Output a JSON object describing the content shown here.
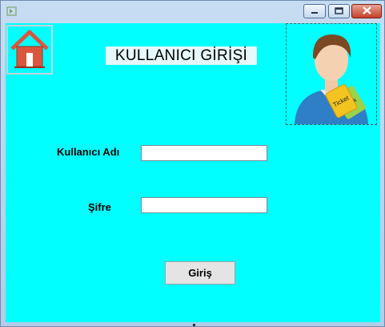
{
  "window": {
    "controls": {
      "minimize_icon": "minimize-icon",
      "maximize_icon": "maximize-icon",
      "close_icon": "close-icon"
    }
  },
  "home_button": {
    "icon": "home-icon"
  },
  "header": {
    "title": "KULLANICI GİRİŞİ"
  },
  "avatar": {
    "ticket_text_1": "Ticket",
    "ticket_text_2": "Tick"
  },
  "form": {
    "username_label": "Kullanıcı Adı",
    "username_value": "",
    "password_label": "Şifre",
    "password_value": ""
  },
  "login_button": {
    "label": "Giriş"
  },
  "colors": {
    "client_background": "#00ffff",
    "title_background": "#e6f8fb",
    "close_red": "#c7402b"
  }
}
